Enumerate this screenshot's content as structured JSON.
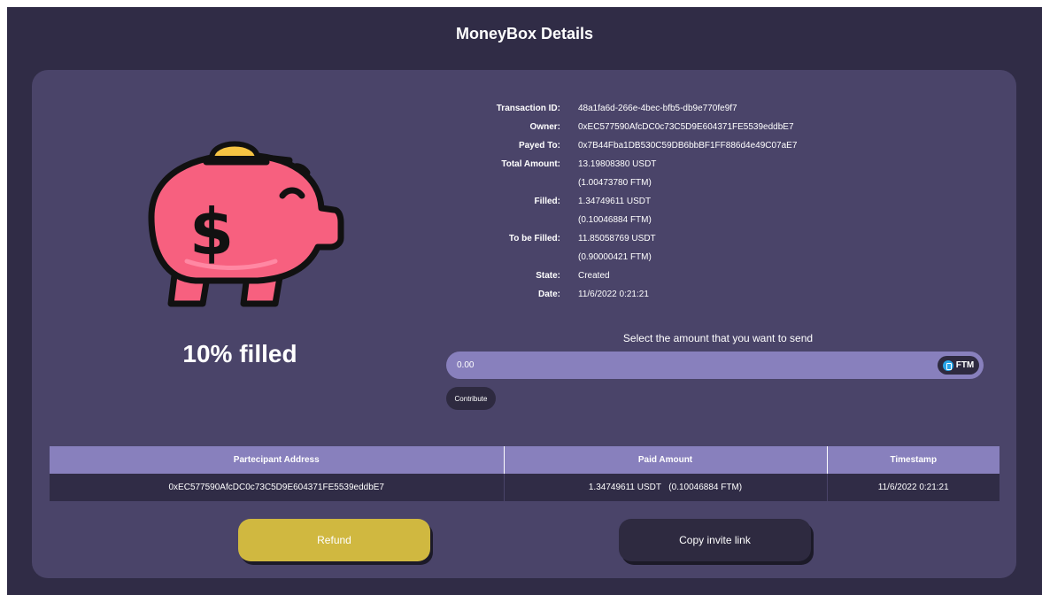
{
  "page": {
    "title": "MoneyBox Details"
  },
  "moneybox": {
    "fill_label": "10% filled",
    "fill_percent": 10,
    "details": [
      {
        "key": "Transaction ID:",
        "value": "48a1fa6d-266e-4bec-bfb5-db9e770fe9f7"
      },
      {
        "key": "Owner:",
        "value": "0xEC577590AfcDC0c73C5D9E604371FE5539eddbE7"
      },
      {
        "key": "Payed To:",
        "value": "0x7B44Fba1DB530C59DB6bbBF1FF886d4e49C07aE7"
      },
      {
        "key": "Total Amount:",
        "value": "13.19808380 USDT"
      },
      {
        "key": "",
        "value": "(1.00473780 FTM)"
      },
      {
        "key": "Filled:",
        "value": "1.34749611 USDT"
      },
      {
        "key": "",
        "value": "(0.10046884 FTM)"
      },
      {
        "key": "To be Filled:",
        "value": "11.85058769 USDT"
      },
      {
        "key": "",
        "value": "(0.90000421 FTM)"
      },
      {
        "key": "State:",
        "value": "Created"
      },
      {
        "key": "Date:",
        "value": "11/6/2022 0:21:21"
      }
    ]
  },
  "send": {
    "label": "Select the amount that you want to send",
    "amount_placeholder": "0.00",
    "currency": "FTM",
    "currency_icon": "fantom-icon",
    "contribute_label": "Contribute"
  },
  "participants": {
    "headers": [
      "Partecipant Address",
      "Paid Amount",
      "Timestamp"
    ],
    "rows": [
      [
        "0xEC577590AfcDC0c73C5D9E604371FE5539eddbE7",
        "1.34749611 USDT   (0.10046884 FTM)",
        "11/6/2022 0:21:21"
      ]
    ]
  },
  "actions": {
    "refund_label": "Refund",
    "copy_invite_label": "Copy invite link"
  },
  "colors": {
    "page_bg": "#302c46",
    "card_bg": "#4a4469",
    "accent_purple": "#8880bd",
    "refund_gold": "#d0b840",
    "pig_pink": "#f7607f",
    "coin_gold": "#f6c443"
  }
}
